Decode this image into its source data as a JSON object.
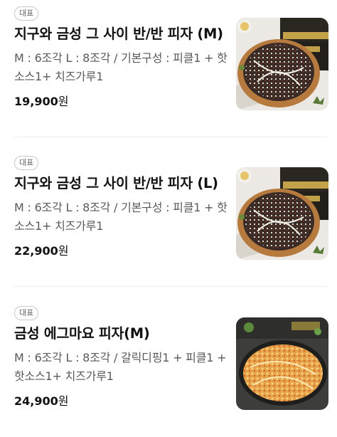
{
  "menu_items": [
    {
      "badge": "대표",
      "name": "지구와 금성 그 사이 반/반 피자 (M)",
      "description": "M : 6조각 L : 8조각 / 기본구성 : 피클1 + 핫소스1+ 치즈가루1",
      "price": "19,900",
      "currency": "원",
      "image": "half-half-pizza-photo"
    },
    {
      "badge": "대표",
      "name": "지구와 금성 그 사이 반/반 피자 (L)",
      "description": "M : 6조각 L : 8조각 / 기본구성 : 피클1 + 핫소스1+ 치즈가루1",
      "price": "22,900",
      "currency": "원",
      "image": "half-half-pizza-photo"
    },
    {
      "badge": "대표",
      "name": "금성 에그마요 피자(M)",
      "description": "M : 6조각 L : 8조각 / 갈릭디핑1 + 피클1 + 핫소스1+ 치즈가루1",
      "price": "24,900",
      "currency": "원",
      "image": "egg-mayo-pizza-photo"
    }
  ]
}
